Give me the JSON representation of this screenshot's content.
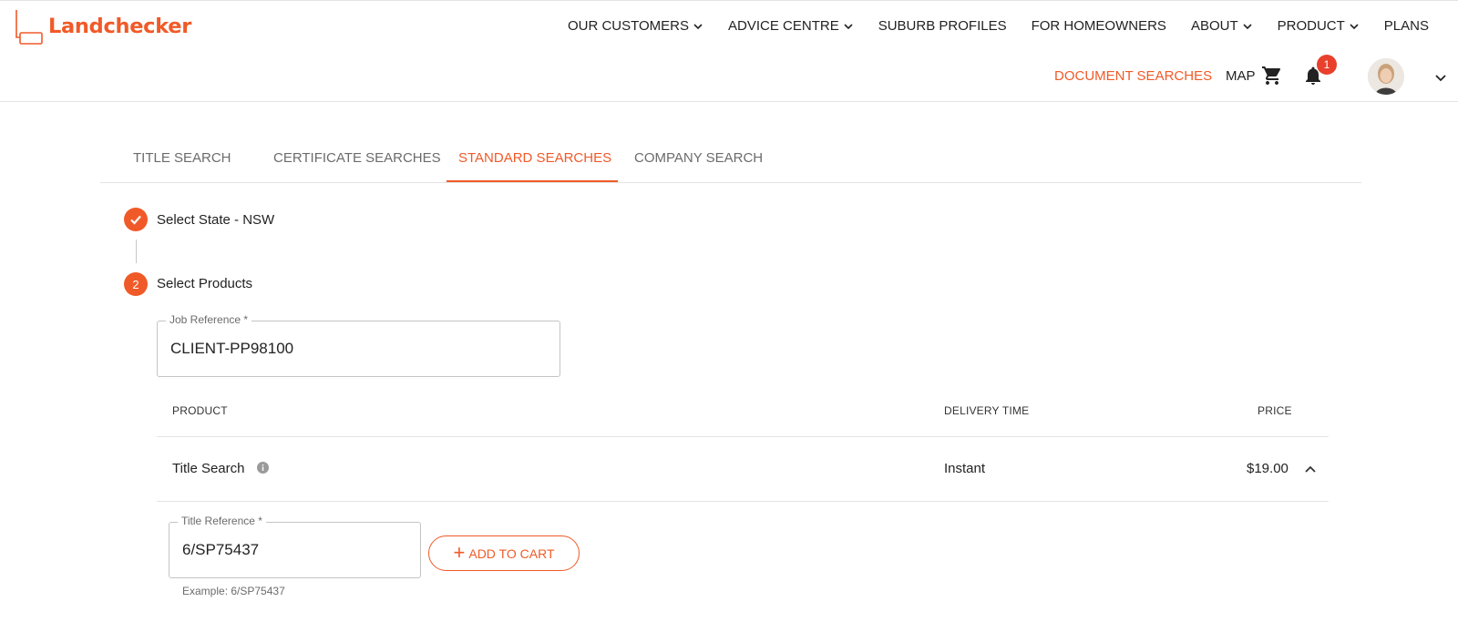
{
  "brand": {
    "name": "Landchecker",
    "accent": "#f05a28"
  },
  "topnav": {
    "items": [
      {
        "label": "OUR CUSTOMERS",
        "dropdown": true
      },
      {
        "label": "ADVICE CENTRE",
        "dropdown": true
      },
      {
        "label": "SUBURB PROFILES",
        "dropdown": false
      },
      {
        "label": "FOR HOMEOWNERS",
        "dropdown": false
      },
      {
        "label": "ABOUT",
        "dropdown": true
      },
      {
        "label": "PRODUCT",
        "dropdown": true
      },
      {
        "label": "PLANS",
        "dropdown": false
      }
    ]
  },
  "subnav": {
    "document_searches": "DOCUMENT SEARCHES",
    "map": "MAP",
    "notification_count": "1",
    "icons": [
      "cart-icon",
      "bell-icon",
      "avatar",
      "chevron-down-icon"
    ]
  },
  "tabs": [
    {
      "label": "TITLE SEARCH",
      "active": false
    },
    {
      "label": "CERTIFICATE SEARCHES",
      "active": false
    },
    {
      "label": "STANDARD SEARCHES",
      "active": true
    },
    {
      "label": "COMPANY SEARCH",
      "active": false
    }
  ],
  "steps": [
    {
      "marker": "check",
      "label": "Select State - NSW"
    },
    {
      "marker": "2",
      "label": "Select Products"
    }
  ],
  "job_reference": {
    "label": "Job Reference *",
    "value": "CLIENT-PP98100"
  },
  "table": {
    "headers": {
      "product": "PRODUCT",
      "delivery": "DELIVERY TIME",
      "price": "PRICE"
    },
    "rows": [
      {
        "product": "Title Search",
        "delivery": "Instant",
        "price": "$19.00",
        "expanded": true
      }
    ]
  },
  "title_reference": {
    "label": "Title Reference *",
    "value": "6/SP75437",
    "helper": "Example: 6/SP75437",
    "add_button": "ADD TO CART"
  }
}
